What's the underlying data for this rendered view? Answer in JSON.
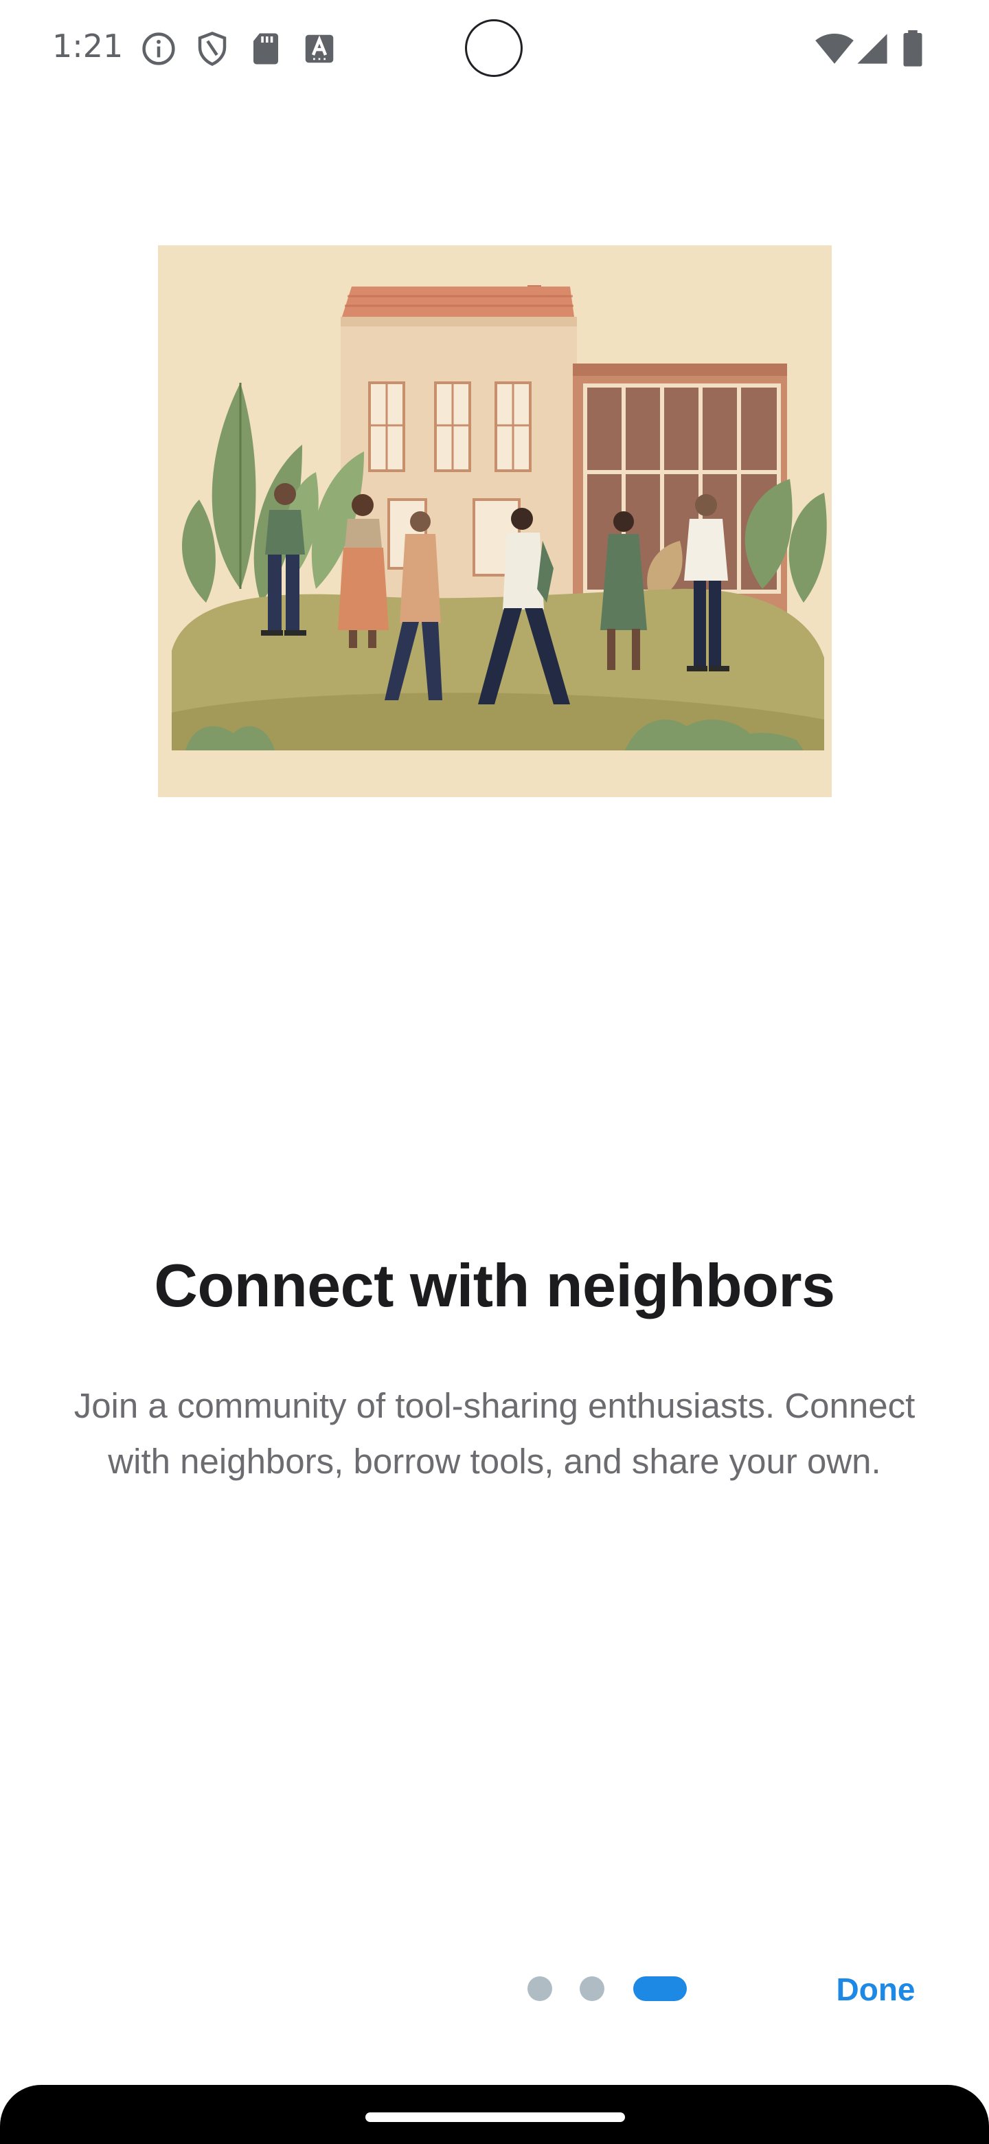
{
  "status_bar": {
    "time": "1:21",
    "icons_left": [
      "info-icon",
      "shield-icon",
      "sd-card-icon",
      "keyboard-a-icon"
    ],
    "icons_right": [
      "wifi-icon",
      "cellular-signal-icon",
      "battery-icon"
    ]
  },
  "onboarding": {
    "illustration": "neighbors-illustration",
    "title": "Connect with neighbors",
    "description": "Join a community of tool-sharing enthusiasts. Connect with neighbors, borrow tools, and share your own.",
    "page_count": 3,
    "current_page": 3,
    "done_label": "Done"
  },
  "colors": {
    "accent": "#1e88e5",
    "inactive_dot": "#b0bcc3",
    "title": "#1c1c1e",
    "body_text": "#6b6b70",
    "illustration_bg": "#f2e1c0"
  }
}
